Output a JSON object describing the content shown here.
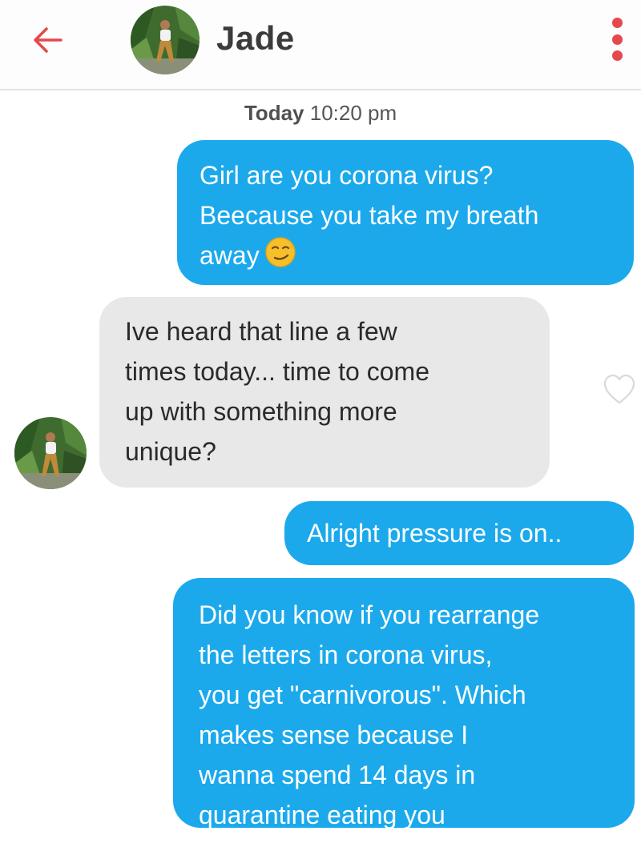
{
  "header": {
    "contact_name": "Jade",
    "accent_color": "#e5484d"
  },
  "timestamp": {
    "day": "Today",
    "time": "10:20 pm"
  },
  "messages": [
    {
      "direction": "outgoing",
      "lines": [
        "Girl are you corona virus?",
        "Beecause you take my breath",
        "away"
      ],
      "emoji": "smirking-face-icon"
    },
    {
      "direction": "incoming",
      "lines": [
        "Ive heard that line a few",
        "times today... time to come",
        "up with something more",
        "unique?"
      ],
      "liked": false
    },
    {
      "direction": "outgoing",
      "lines": [
        "Alright pressure is on.."
      ]
    },
    {
      "direction": "outgoing",
      "lines": [
        "Did you know if you rearrange",
        "the letters in corona virus,",
        "you get \"carnivorous\". Which",
        "makes sense because I",
        "wanna spend 14 days in",
        "quarantine eating you"
      ]
    }
  ],
  "colors": {
    "outgoing_bubble": "#1ba9ec",
    "incoming_bubble": "#e8e8e8"
  }
}
